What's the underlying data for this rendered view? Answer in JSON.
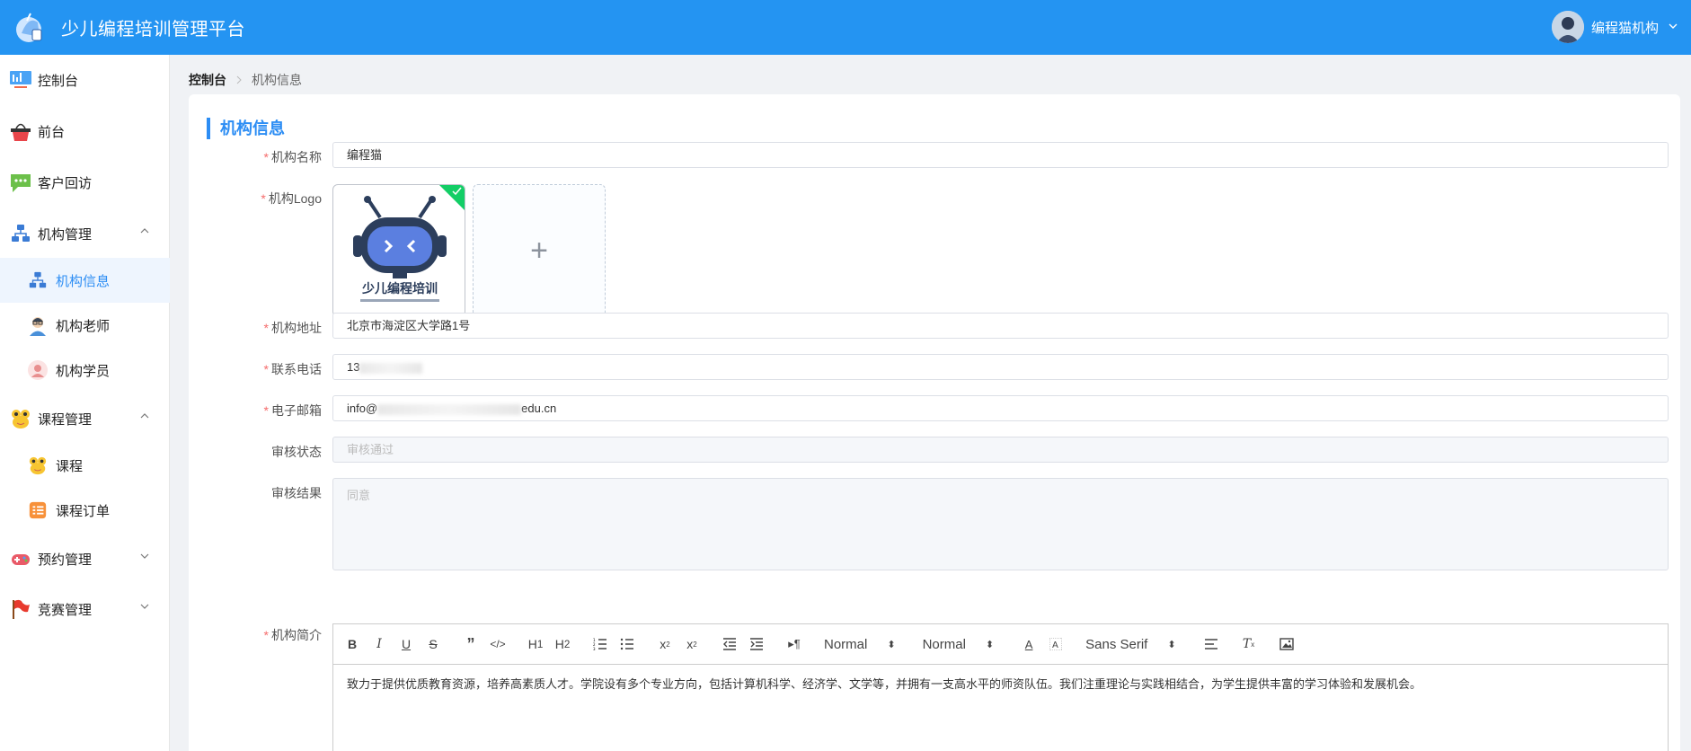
{
  "header": {
    "app_title": "少儿编程培训管理平台",
    "user_name": "编程猫机构",
    "bg_color": "#2494f2"
  },
  "sidebar": {
    "items": [
      {
        "label": "控制台",
        "icon": "dashboard-icon"
      },
      {
        "label": "前台",
        "icon": "basket-icon"
      },
      {
        "label": "客户回访",
        "icon": "chat-icon"
      },
      {
        "label": "机构管理",
        "icon": "org-chart-icon",
        "expanded": true,
        "children": [
          {
            "label": "机构信息",
            "icon": "org-chart-icon",
            "active": true
          },
          {
            "label": "机构老师",
            "icon": "teacher-icon"
          },
          {
            "label": "机构学员",
            "icon": "student-icon"
          }
        ]
      },
      {
        "label": "课程管理",
        "icon": "frog-icon",
        "expanded": true,
        "children": [
          {
            "label": "课程",
            "icon": "frog-icon"
          },
          {
            "label": "课程订单",
            "icon": "order-list-icon"
          }
        ]
      },
      {
        "label": "预约管理",
        "icon": "gamepad-icon",
        "expanded": false
      },
      {
        "label": "竞赛管理",
        "icon": "flag-icon",
        "expanded": false
      }
    ]
  },
  "breadcrumb": {
    "home": "控制台",
    "current": "机构信息"
  },
  "form": {
    "section_title": "机构信息",
    "name": {
      "label": "机构名称",
      "value": "编程猫"
    },
    "logo": {
      "label": "机构Logo",
      "caption": "少儿编程培训",
      "add_symbol": "+"
    },
    "address": {
      "label": "机构地址",
      "value": "北京市海淀区大学路1号"
    },
    "phone": {
      "label": "联系电话",
      "value_prefix": "13"
    },
    "email": {
      "label": "电子邮箱",
      "value_prefix": "info@",
      "value_suffix": "edu.cn"
    },
    "audit_status": {
      "label": "审核状态",
      "placeholder": "审核通过"
    },
    "audit_result": {
      "label": "审核结果",
      "placeholder": "同意"
    },
    "intro": {
      "label": "机构简介",
      "header_picker": "Normal",
      "size_picker": "Normal",
      "font_picker": "Sans Serif",
      "content": "致力于提供优质教育资源，培养高素质人才。学院设有多个专业方向，包括计算机科学、经济学、文学等，并拥有一支高水平的师资队伍。我们注重理论与实践相结合，为学生提供丰富的学习体验和发展机会。"
    }
  }
}
